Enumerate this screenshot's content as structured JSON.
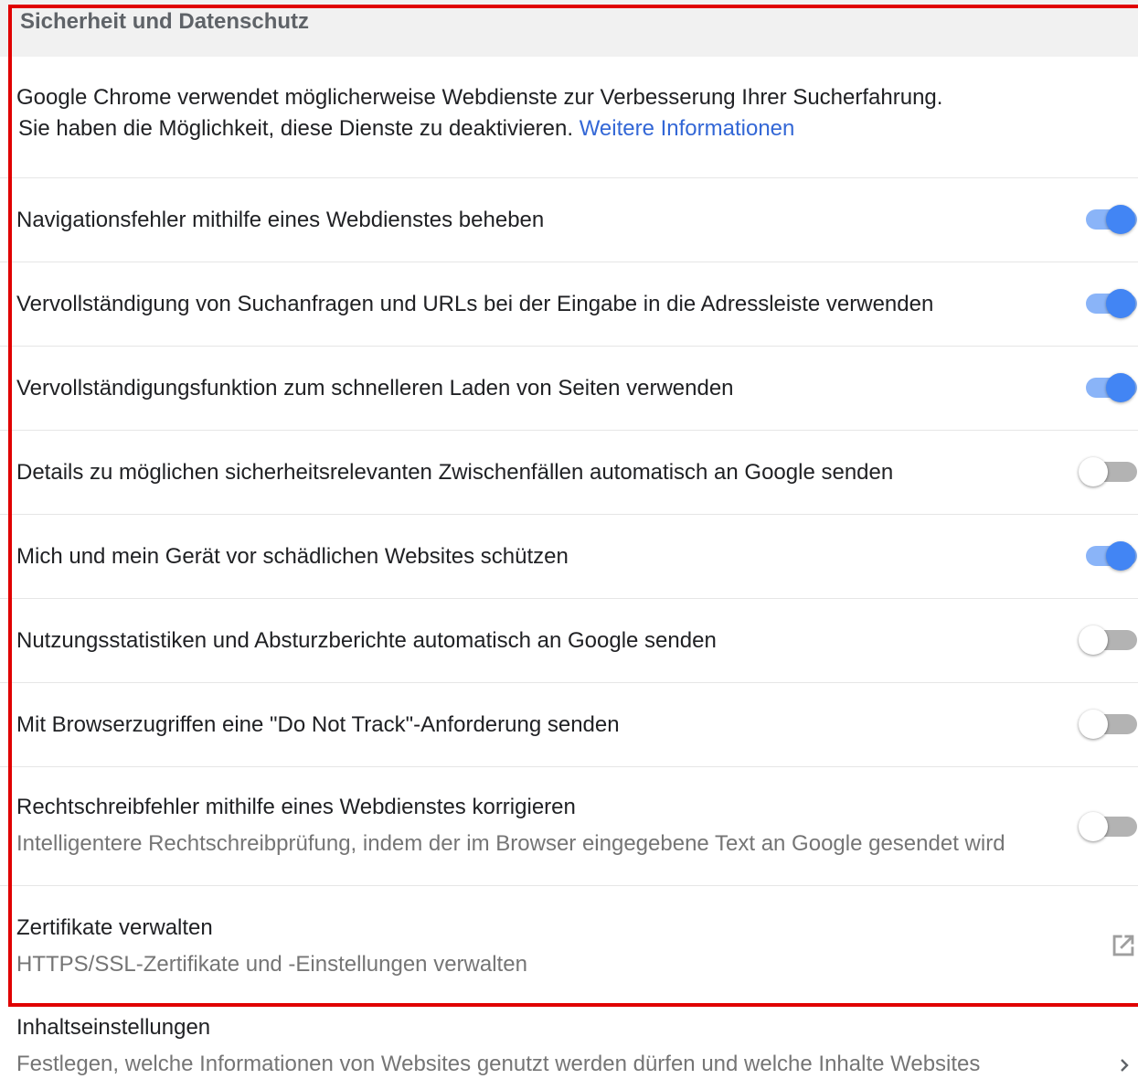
{
  "section": {
    "title": "Sicherheit und Datenschutz"
  },
  "intro": {
    "line1": "Google Chrome verwendet möglicherweise Webdienste zur Verbesserung Ihrer Sucherfahrung.",
    "line2": "Sie haben die  Möglichkeit, diese Dienste zu deaktivieren. ",
    "link": "Weitere Informationen"
  },
  "settings": [
    {
      "label": "Navigationsfehler mithilfe eines Webdienstes beheben",
      "enabled": true
    },
    {
      "label": "Vervollständigung von Suchanfragen und URLs bei der Eingabe in die Adressleiste verwenden",
      "enabled": true
    },
    {
      "label": "Vervollständigungsfunktion zum schnelleren Laden von Seiten verwenden",
      "enabled": true
    },
    {
      "label": "Details zu möglichen sicherheitsrelevanten Zwischenfällen automatisch an Google senden",
      "enabled": false
    },
    {
      "label": "Mich und mein Gerät vor schädlichen Websites schützen",
      "enabled": true
    },
    {
      "label": "Nutzungsstatistiken und Absturzberichte automatisch an Google senden",
      "enabled": false
    },
    {
      "label": "Mit Browserzugriffen eine \"Do Not Track\"-Anforderung senden",
      "enabled": false
    },
    {
      "label": "Rechtschreibfehler mithilfe eines Webdienstes korrigieren",
      "sublabel": "Intelligentere Rechtschreibprüfung, indem der im Browser eingegebene Text an Google gesendet wird",
      "enabled": false
    }
  ],
  "certificates": {
    "label": "Zertifikate verwalten",
    "sublabel": "HTTPS/SSL-Zertifikate und -Einstellungen verwalten",
    "icon": "open-in-new-icon"
  },
  "content_settings": {
    "label": "Inhaltseinstellungen",
    "sublabel": "Festlegen, welche Informationen von Websites genutzt werden dürfen und welche Inhalte Websites",
    "icon": "chevron-right-icon"
  },
  "colors": {
    "accent": "#4285f4",
    "accent_track": "#8ab4f8",
    "link": "#3367d6",
    "highlight_border": "#e00000"
  }
}
